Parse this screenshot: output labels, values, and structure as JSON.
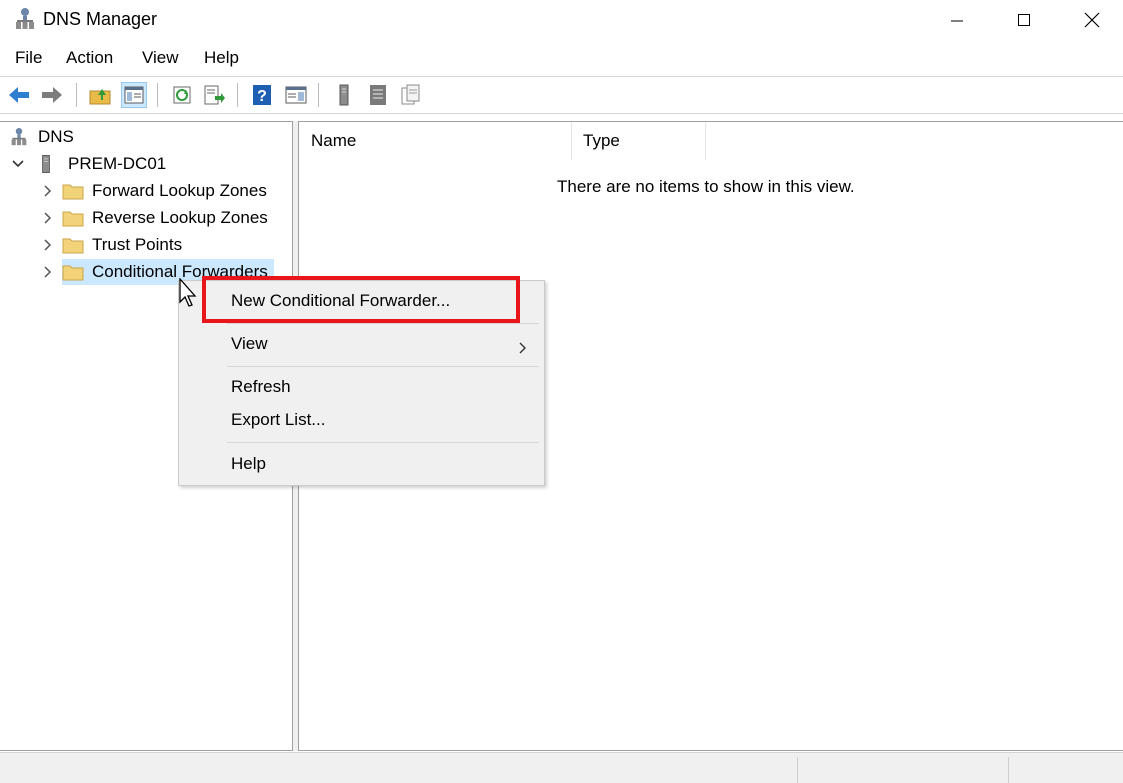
{
  "window": {
    "title": "DNS Manager",
    "controls": [
      "minimize",
      "maximize",
      "close"
    ]
  },
  "menu": [
    "File",
    "Action",
    "View",
    "Help"
  ],
  "toolbar": {
    "buttons": [
      "back-icon",
      "forward-icon",
      "up-folder-icon",
      "show-hide-console-tree-icon",
      "refresh-icon",
      "export-list-icon",
      "help-icon",
      "action-pane-icon",
      "server-icon",
      "list-icon",
      "properties-icon"
    ]
  },
  "tree": {
    "root": "DNS",
    "server": "PREM-DC01",
    "items": [
      {
        "label": "Forward Lookup Zones"
      },
      {
        "label": "Reverse Lookup Zones"
      },
      {
        "label": "Trust Points"
      },
      {
        "label": "Conditional Forwarders",
        "selected": true
      }
    ]
  },
  "list": {
    "columns": [
      "Name",
      "Type"
    ],
    "empty_message": "There are no items to show in this view."
  },
  "context_menu": {
    "items": [
      {
        "label": "New Conditional Forwarder...",
        "highlighted": true
      },
      {
        "label": "View",
        "submenu": true
      },
      {
        "label": "Refresh"
      },
      {
        "label": "Export List..."
      },
      {
        "label": "Help"
      }
    ]
  },
  "colors": {
    "selection": "#cce8ff",
    "highlight_box": "#e8151b",
    "folder": "#f3d37a",
    "back_forward": "#2f7fd1"
  }
}
